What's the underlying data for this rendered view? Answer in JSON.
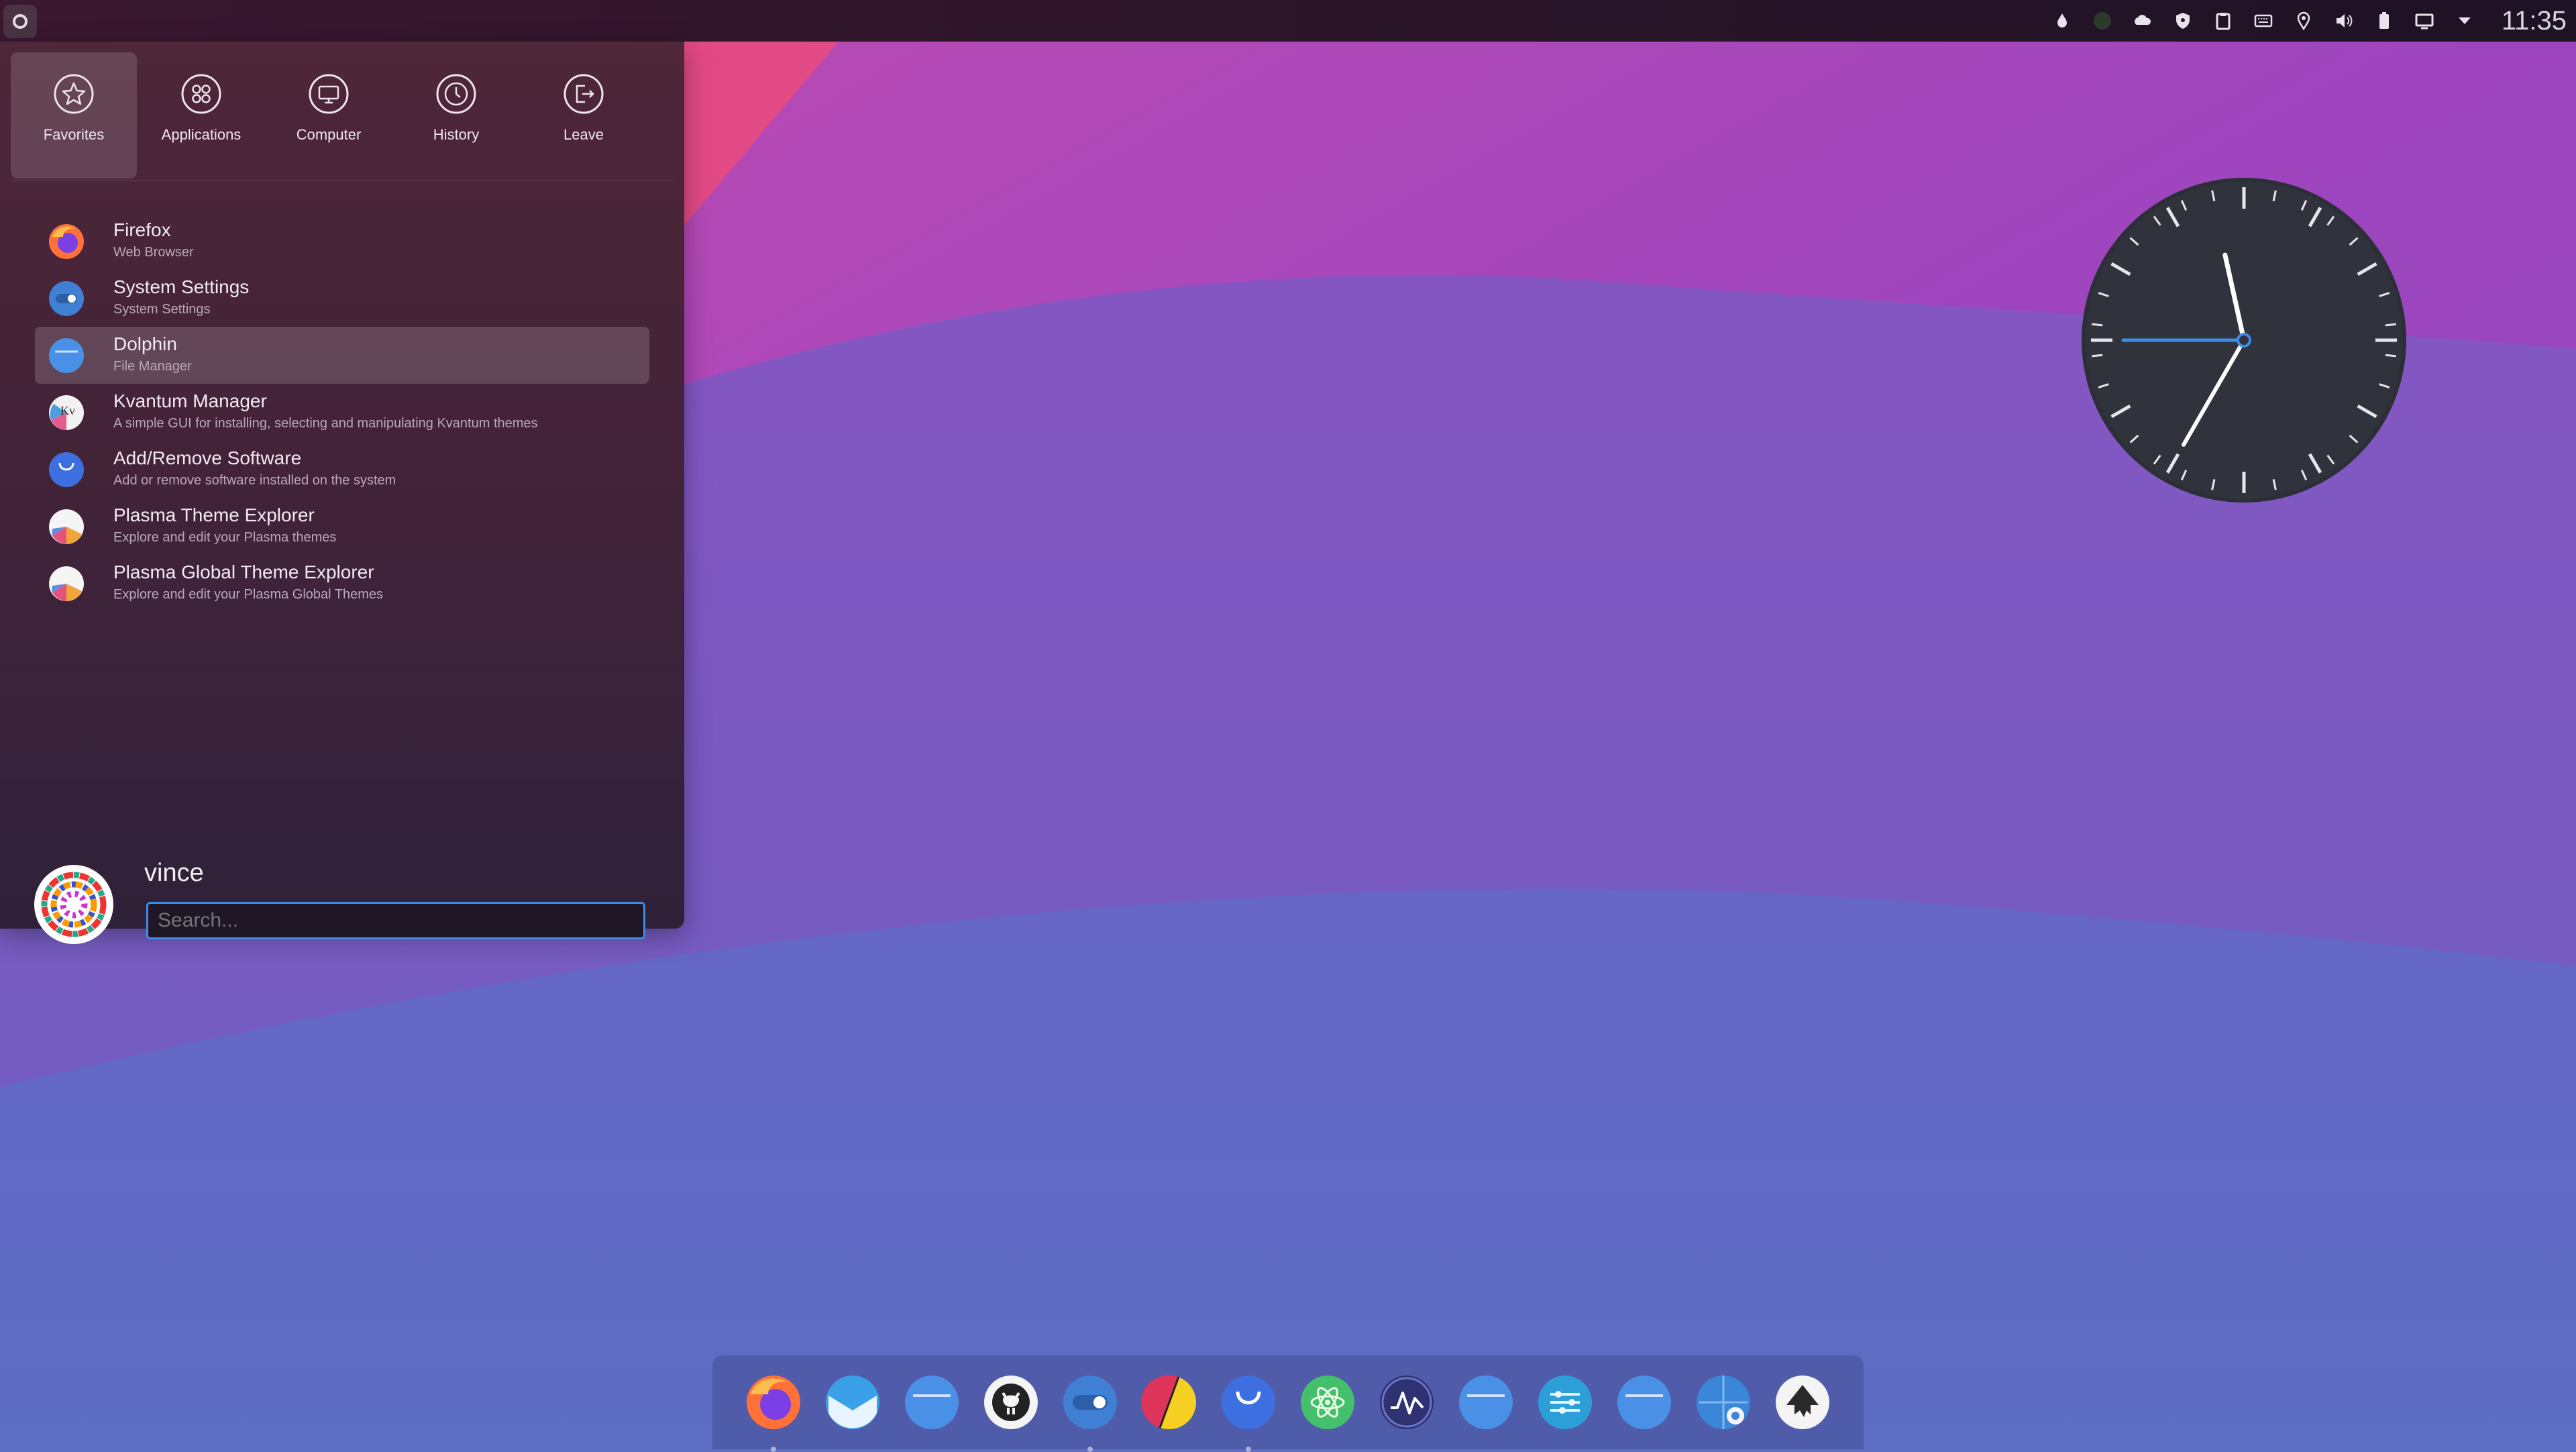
{
  "panel": {
    "tray_icons": [
      "drop-icon",
      "circle-icon",
      "cloud-icon",
      "shield-icon",
      "clipboard-icon",
      "keyboard-icon",
      "location-icon",
      "volume-icon",
      "battery-icon",
      "display-icon",
      "chevron-down-icon"
    ],
    "time": "11:35"
  },
  "menu": {
    "tabs": [
      {
        "label": "Favorites",
        "icon": "star-icon",
        "active": true
      },
      {
        "label": "Applications",
        "icon": "apps-icon",
        "active": false
      },
      {
        "label": "Computer",
        "icon": "monitor-icon",
        "active": false
      },
      {
        "label": "History",
        "icon": "clock-icon",
        "active": false
      },
      {
        "label": "Leave",
        "icon": "logout-icon",
        "active": false
      }
    ],
    "favorites": [
      {
        "name": "Firefox",
        "desc": "Web Browser",
        "icon": "firefox-icon"
      },
      {
        "name": "System Settings",
        "desc": "System Settings",
        "icon": "settings-icon"
      },
      {
        "name": "Dolphin",
        "desc": "File Manager",
        "icon": "folder-icon"
      },
      {
        "name": "Kvantum Manager",
        "desc": "A simple GUI for installing, selecting and manipulating Kvantum themes",
        "icon": "kvantum-icon"
      },
      {
        "name": "Add/Remove Software",
        "desc": "Add or remove software installed on the system",
        "icon": "store-icon"
      },
      {
        "name": "Plasma Theme Explorer",
        "desc": "Explore and edit your Plasma themes",
        "icon": "theme-icon"
      },
      {
        "name": "Plasma Global Theme Explorer",
        "desc": "Explore and edit your Plasma Global Themes",
        "icon": "global-theme-icon"
      }
    ],
    "user": "vince",
    "search_placeholder": "Search..."
  },
  "clock_widget": {
    "hours": 11,
    "minutes": 35,
    "seconds": 45
  },
  "colors": {
    "accent": "#3d8ee8",
    "menu_text": "#f2eaf1"
  },
  "dock": {
    "items": [
      "firefox-icon",
      "email-icon",
      "folder-icon",
      "github-icon",
      "settings-icon",
      "color-icon",
      "store-icon",
      "atom-icon",
      "monitor-icon",
      "folder-icon",
      "mixer-icon",
      "folder-icon",
      "image-viewer-icon",
      "inkscape-icon"
    ],
    "running_indicators": [
      0,
      4,
      6
    ]
  }
}
